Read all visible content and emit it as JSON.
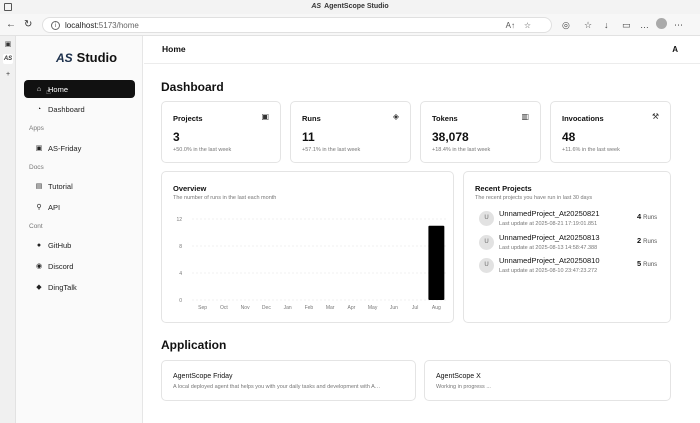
{
  "window": {
    "title": "AgentScope Studio",
    "logo": "AS"
  },
  "browser": {
    "url_host": "localhost:",
    "url_path": "5173/home",
    "tab_logo": "AS"
  },
  "sidebar": {
    "brand_mark": "AS",
    "brand_name": "Studio",
    "items": [
      {
        "label": "Home",
        "icon": "home-icon"
      },
      {
        "label": "Dashboard",
        "icon": "dashboard-icon"
      }
    ],
    "sections": [
      {
        "title": "Apps",
        "items": [
          {
            "label": "AS-Friday",
            "icon": "app-icon"
          }
        ]
      },
      {
        "title": "Docs",
        "items": [
          {
            "label": "Tutorial",
            "icon": "book-icon"
          },
          {
            "label": "API",
            "icon": "link-icon"
          }
        ]
      },
      {
        "title": "Cont",
        "items": [
          {
            "label": "GitHub",
            "icon": "github-icon"
          },
          {
            "label": "Discord",
            "icon": "discord-icon"
          },
          {
            "label": "DingTalk",
            "icon": "dingtalk-icon"
          }
        ]
      }
    ]
  },
  "header": {
    "title": "Home",
    "lang_icon": "translate-icon"
  },
  "dashboard": {
    "title": "Dashboard",
    "stats": [
      {
        "label": "Projects",
        "value": "3",
        "sub": "+50.0% in the last week",
        "icon": "window-icon"
      },
      {
        "label": "Runs",
        "value": "11",
        "sub": "+57.1% in the last week",
        "icon": "layers-icon"
      },
      {
        "label": "Tokens",
        "value": "38,078",
        "sub": "+18.4% in the last week",
        "icon": "bar-icon"
      },
      {
        "label": "Invocations",
        "value": "48",
        "sub": "+11.6% in the last week",
        "icon": "wrench-icon"
      }
    ],
    "overview": {
      "title": "Overview",
      "desc": "The number of runs in the last each month"
    },
    "recent": {
      "title": "Recent Projects",
      "desc": "The recent projects you have run in last 30 days",
      "runs_label": "Runs",
      "items": [
        {
          "avatar": "U",
          "name": "UnnamedProject_At20250821",
          "updated": "Last update at 2025-08-21 17:19:01.851",
          "runs": "4"
        },
        {
          "avatar": "U",
          "name": "UnnamedProject_At20250813",
          "updated": "Last update at 2025-08-13 14:58:47.388",
          "runs": "2"
        },
        {
          "avatar": "U",
          "name": "UnnamedProject_At20250810",
          "updated": "Last update at 2025-08-10 23:47:23.272",
          "runs": "5"
        }
      ]
    }
  },
  "application": {
    "title": "Application",
    "apps": [
      {
        "name": "AgentScope Friday",
        "desc": "A local deployed agent that helps you with your daily tasks and development with Age..."
      },
      {
        "name": "AgentScope X",
        "desc": "Working in progress ..."
      }
    ]
  },
  "chart_data": {
    "type": "bar",
    "categories": [
      "Sep",
      "Oct",
      "Nov",
      "Dec",
      "Jan",
      "Feb",
      "Mar",
      "Apr",
      "May",
      "Jun",
      "Jul",
      "Aug"
    ],
    "values": [
      0,
      0,
      0,
      0,
      0,
      0,
      0,
      0,
      0,
      0,
      0,
      11
    ],
    "yticks": [
      0,
      4,
      8,
      12
    ],
    "ylim": [
      0,
      12
    ],
    "grid": true,
    "bar_color": "#000000"
  }
}
